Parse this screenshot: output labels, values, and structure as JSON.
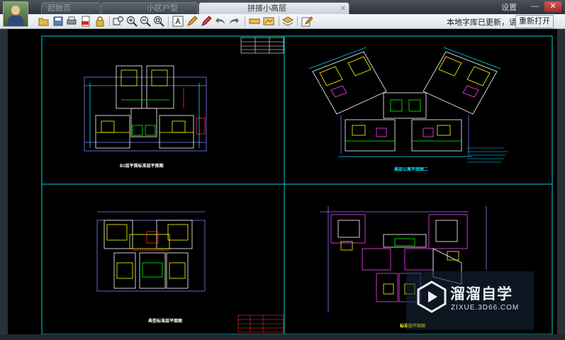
{
  "window": {
    "tabs": [
      {
        "label": "起始页",
        "active": false
      },
      {
        "label": "小区户型",
        "active": false
      },
      {
        "label": "拼接小高层",
        "active": true
      }
    ],
    "settings_label": "设置",
    "minimize_glyph": "—",
    "close_glyph": "✕"
  },
  "toolbar": {
    "icons": [
      "open-icon",
      "save-icon",
      "print-icon",
      "export-pdf-icon",
      "lock-icon",
      "zoom-window-icon",
      "zoom-in-icon",
      "zoom-out-icon",
      "zoom-extents-icon",
      "text-icon",
      "pen-icon",
      "highlighter-icon",
      "undo-icon",
      "redo-icon",
      "layer-icon",
      "pan-icon",
      "layers-stack-icon",
      "edit-icon"
    ],
    "notice": "本地字库已更新，请",
    "reopen_label": "重新打开"
  },
  "drawing": {
    "captions": [
      {
        "text": "B1层平面标准层平面图",
        "color": "#ffffff"
      },
      {
        "text": "高层公寓平面图二",
        "color": "#00e0ff"
      },
      {
        "text": "典型标准层平面图",
        "color": "#ffffff"
      },
      {
        "text": "标准层平面图",
        "color": "#ffff00"
      }
    ]
  },
  "watermark": {
    "brand": "溜溜自学",
    "url": "ZIXUE.3D66.COM"
  }
}
